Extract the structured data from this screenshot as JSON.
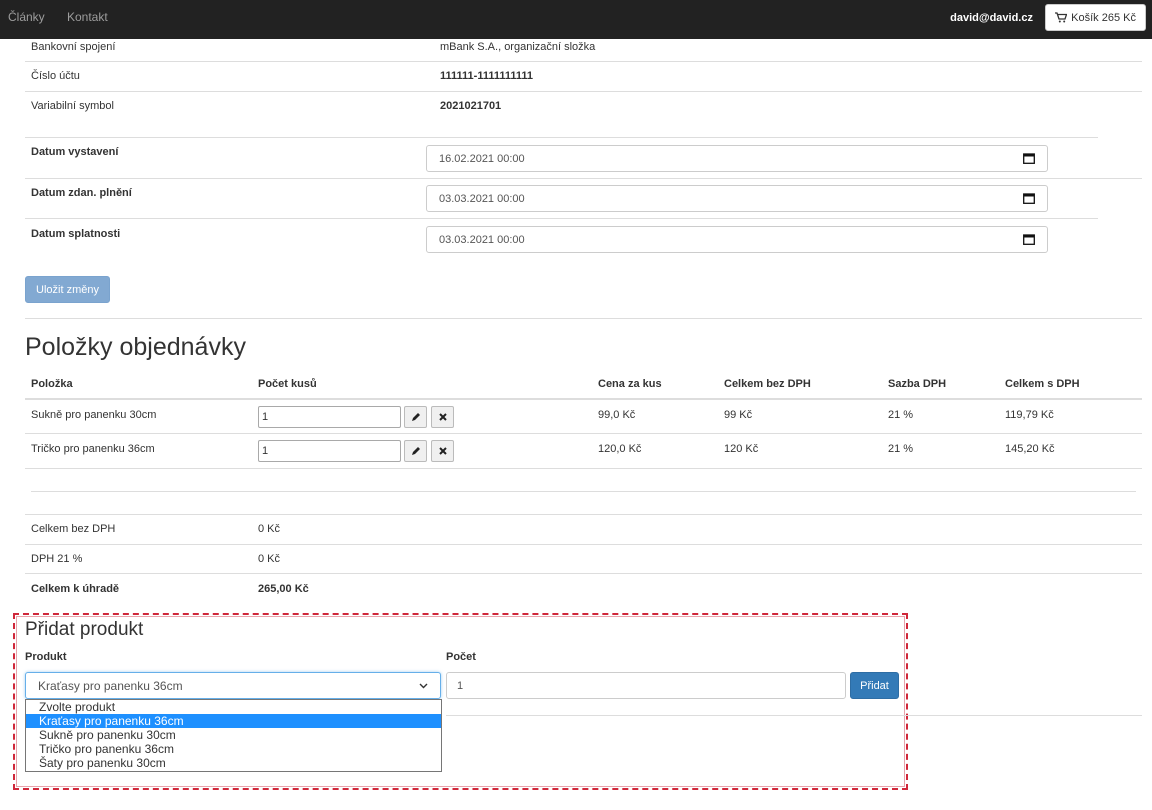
{
  "nav": {
    "links": [
      "Články",
      "Kontakt"
    ],
    "user_email": "david@david.cz",
    "cart_label": "Košík 265 Kč"
  },
  "payment": {
    "rows": [
      {
        "label": "Bankovní spojení",
        "value": "mBank S.A., organizační složka"
      },
      {
        "label": "Číslo účtu",
        "value": "111111-1111111111"
      },
      {
        "label": "Variabilní symbol",
        "value": "2021021701"
      }
    ]
  },
  "dates": [
    {
      "label": "Datum vystavení",
      "value": "16.02.2021 00:00"
    },
    {
      "label": "Datum zdan. plnění",
      "value": "03.03.2021 00:00"
    },
    {
      "label": "Datum splatnosti",
      "value": "03.03.2021 00:00"
    }
  ],
  "save_label": "Uložit změny",
  "items_section": {
    "title": "Položky objednávky",
    "headers": [
      "Položka",
      "Počet kusů",
      "Cena za kus",
      "Celkem bez DPH",
      "Sazba DPH",
      "Celkem s DPH"
    ],
    "rows": [
      {
        "name": "Sukně pro panenku 30cm",
        "qty": "1",
        "unit_price": "99,0 Kč",
        "total_no_vat": "99 Kč",
        "vat_rate": "21 %",
        "total_vat": "119,79 Kč"
      },
      {
        "name": "Tričko pro panenku 36cm",
        "qty": "1",
        "unit_price": "120,0 Kč",
        "total_no_vat": "120 Kč",
        "vat_rate": "21 %",
        "total_vat": "145,20 Kč"
      }
    ]
  },
  "summary": [
    {
      "label": "Celkem bez DPH",
      "value": "0 Kč"
    },
    {
      "label": "DPH 21 %",
      "value": "0 Kč"
    },
    {
      "label": "Celkem k úhradě",
      "value": "265,00 Kč"
    }
  ],
  "add_product": {
    "title": "Přidat produkt",
    "product_label": "Produkt",
    "count_label": "Počet",
    "selected": "Kraťasy pro panenku 36cm",
    "count_value": "1",
    "add_label": "Přidat",
    "options": [
      "Zvolte produkt",
      "Kraťasy pro panenku 36cm",
      "Sukně pro panenku 30cm",
      "Tričko pro panenku 36cm",
      "Šaty pro panenku 30cm"
    ],
    "highlighted_option": "Kraťasy pro panenku 36cm"
  },
  "colors": {
    "navbar": "#222222",
    "primary": "#337ab7",
    "highlight": "#1e90ff",
    "panel_border": "#d0273a"
  },
  "icons": {
    "cart": "cart-icon",
    "calendar": "calendar-icon",
    "edit": "pencil-icon",
    "remove": "x-icon",
    "dropdown": "chevron-down-icon"
  }
}
